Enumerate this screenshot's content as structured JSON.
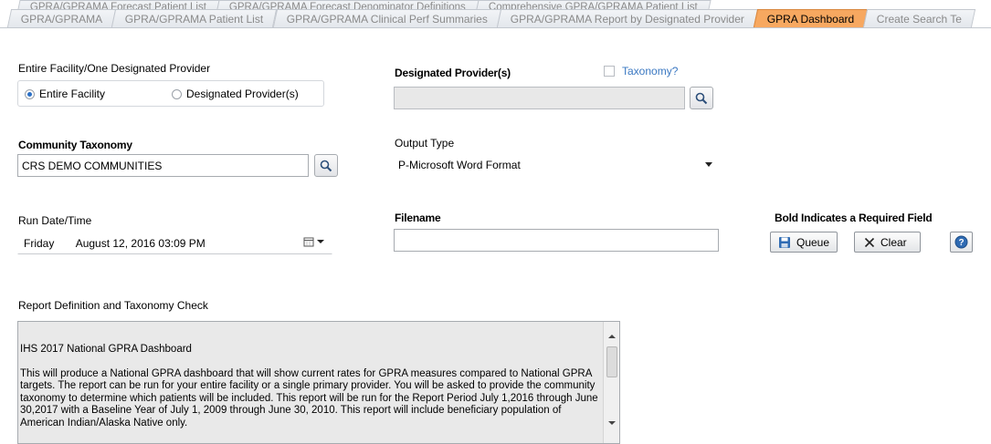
{
  "tabs_row1": [
    "GPRA/GPRAMA Forecast Patient List",
    "GPRA/GPRAMA Forecast Denominator Definitions",
    "Comprehensive GPRA/GPRAMA Patient List"
  ],
  "tabs_row2": [
    "GPRA/GPRAMA",
    "GPRA/GPRAMA Patient List",
    "GPRA/GPRAMA Clinical Perf Summaries",
    "GPRA/GPRAMA Report by Designated Provider",
    "GPRA Dashboard",
    "Create Search Te"
  ],
  "active_tab": "GPRA Dashboard",
  "facility": {
    "label": "Entire Facility/One Designated Provider",
    "option_entire": "Entire Facility",
    "option_provider": "Designated Provider(s)",
    "selected": "Entire Facility"
  },
  "designated_provider": {
    "label": "Designated Provider(s)",
    "taxonomy_label": "Taxonomy?",
    "value": ""
  },
  "community_taxonomy": {
    "label": "Community Taxonomy",
    "value": "CRS DEMO COMMUNITIES"
  },
  "output_type": {
    "label": "Output Type",
    "value": "P-Microsoft Word Format"
  },
  "run_datetime": {
    "label": "Run Date/Time",
    "day": "Friday",
    "date": "August  12, 2016  03:09 PM"
  },
  "filename": {
    "label": "Filename",
    "value": ""
  },
  "required_note": "Bold Indicates a Required Field",
  "buttons": {
    "queue": "Queue",
    "clear": "Clear"
  },
  "report_definition": {
    "label": "Report Definition and Taxonomy Check",
    "title": "IHS 2017 National GPRA Dashboard",
    "body": "This will produce a National GPRA dashboard that will show current rates for GPRA measures compared to National GPRA targets. The report can be run for your entire facility or a single primary provider. You will be asked to provide the community taxonomy to determine which patients will be included. This report will be run for the Report Period July 1,2016 through June 30,2017 with a Baseline Year of July 1, 2009 through June 30, 2010. This report will include beneficiary population of American Indian/Alaska Native only."
  },
  "colors": {
    "active_tab": "#f7a860",
    "accent_blue": "#2b6fc5"
  }
}
